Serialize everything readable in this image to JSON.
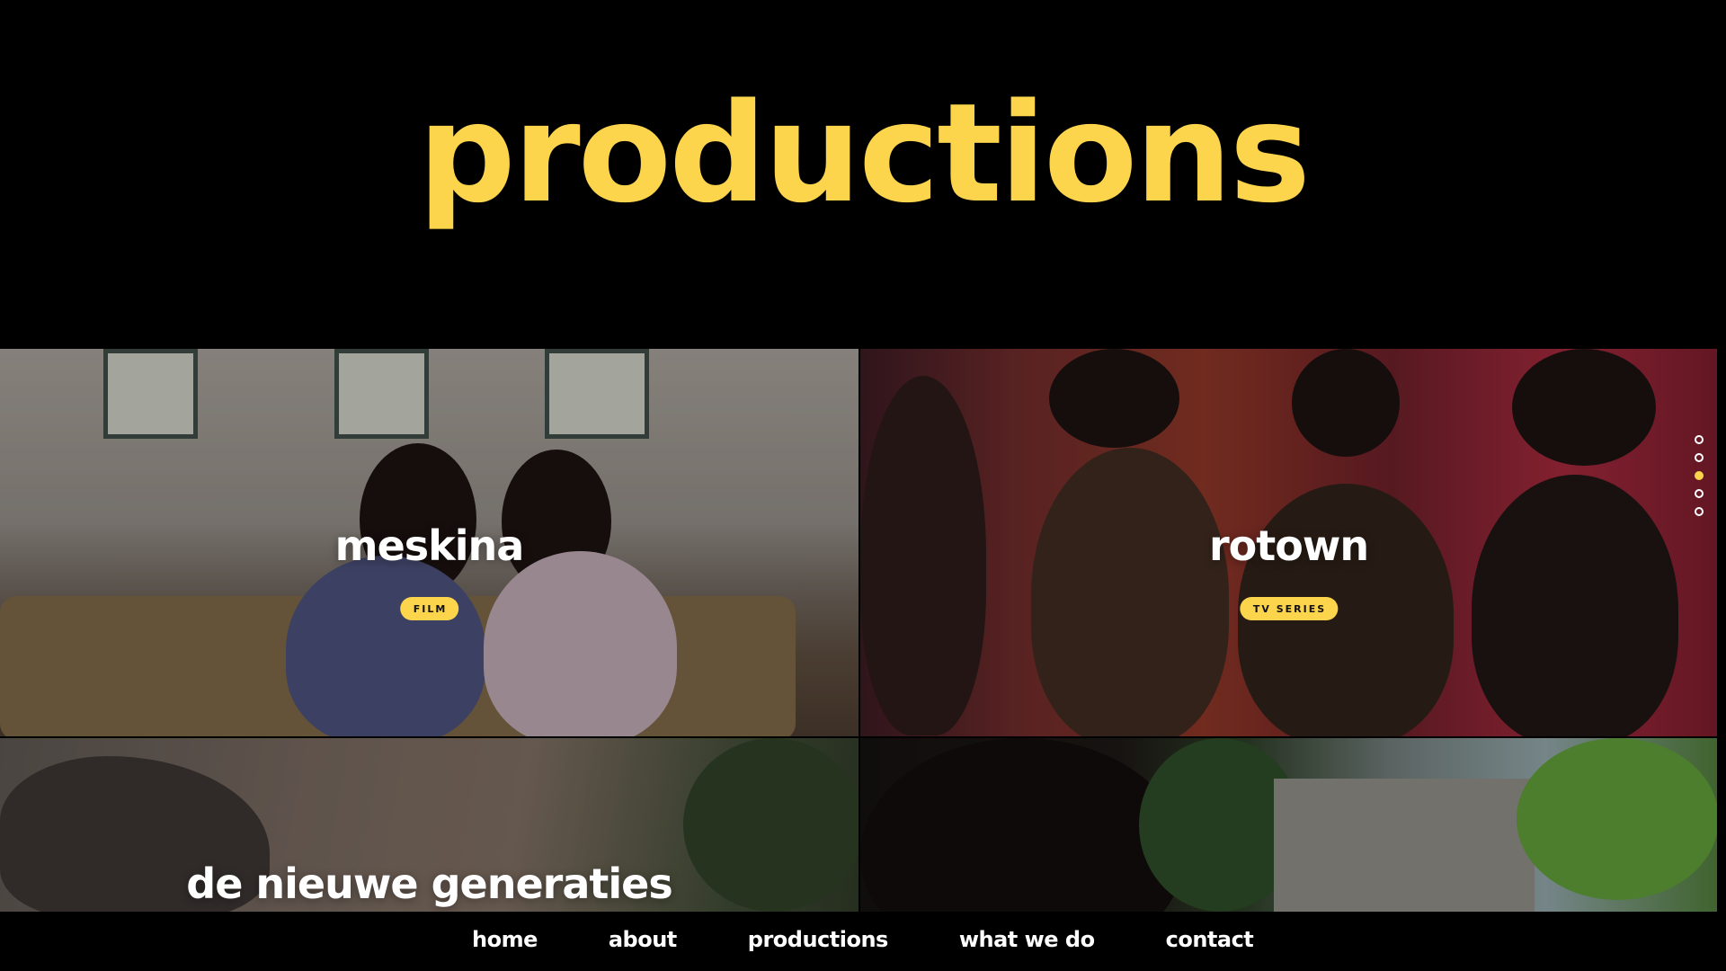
{
  "header": {
    "title": "productions"
  },
  "tiles": [
    {
      "title": "meskina",
      "badge": "FILM"
    },
    {
      "title": "rotown",
      "badge": "TV SERIES"
    },
    {
      "title": "de nieuwe generaties",
      "badge": ""
    },
    {
      "title": "",
      "badge": ""
    }
  ],
  "pager": {
    "count": 5,
    "active_index": 2
  },
  "nav": {
    "items": [
      {
        "label": "home"
      },
      {
        "label": "about"
      },
      {
        "label": "productions"
      },
      {
        "label": "what we do"
      },
      {
        "label": "contact"
      }
    ]
  },
  "colors": {
    "background": "#000000",
    "accent": "#fdd54d",
    "text": "#ffffff"
  }
}
